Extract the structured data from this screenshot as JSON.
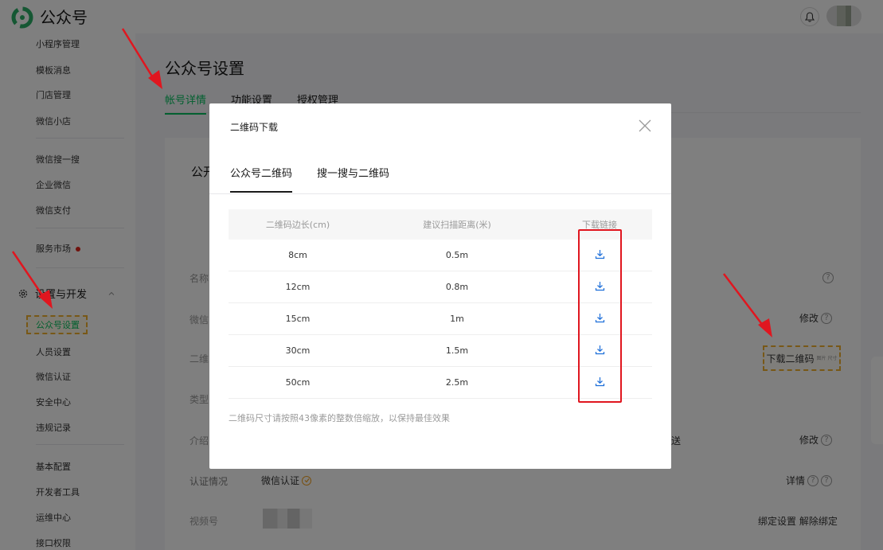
{
  "topbar": {
    "title": "公众号"
  },
  "sidebar": {
    "items_top": [
      "小程序管理",
      "模板消息",
      "门店管理",
      "微信小店"
    ],
    "items_mid": [
      "微信搜一搜",
      "企业微信",
      "微信支付"
    ],
    "service_market": "服务市场",
    "group_label": "设置与开发",
    "items_group": [
      "公众号设置",
      "人员设置",
      "微信认证",
      "安全中心",
      "违规记录"
    ],
    "items_bottom": [
      "基本配置",
      "开发者工具",
      "运维中心",
      "接口权限"
    ]
  },
  "main": {
    "title": "公众号设置",
    "tabs": [
      "帐号详情",
      "功能设置",
      "授权管理"
    ],
    "card_heading": "公开",
    "rows": {
      "name_label": "名称",
      "wechat_label": "微信",
      "qrcode_label": "二维",
      "type_label": "类型",
      "intro_label": "介绍",
      "intro_tail": "送",
      "verify_label": "认证情况",
      "verify_value": "微信认证",
      "channel_label": "视频号"
    },
    "actions": {
      "modify": "修改",
      "download_qr": "下载二维码",
      "download_qr_small": "图片 尺寸",
      "details": "详情",
      "bind_settings": "绑定设置",
      "unbind": "解除绑定"
    }
  },
  "modal": {
    "title": "二维码下载",
    "tabs": [
      "公众号二维码",
      "搜一搜与二维码"
    ],
    "columns": [
      "二维码边长(cm)",
      "建议扫描距离(米)",
      "下载链接"
    ],
    "rows": [
      {
        "size": "8cm",
        "distance": "0.5m"
      },
      {
        "size": "12cm",
        "distance": "0.8m"
      },
      {
        "size": "15cm",
        "distance": "1m"
      },
      {
        "size": "30cm",
        "distance": "1.5m"
      },
      {
        "size": "50cm",
        "distance": "2.5m"
      }
    ],
    "note": "二维码尺寸请按照43像素的整数倍缩放，以保持最佳效果"
  },
  "colors": {
    "brand_green": "#07c160",
    "highlight_red": "#e0161f",
    "annotation_orange": "#f0b12f"
  }
}
